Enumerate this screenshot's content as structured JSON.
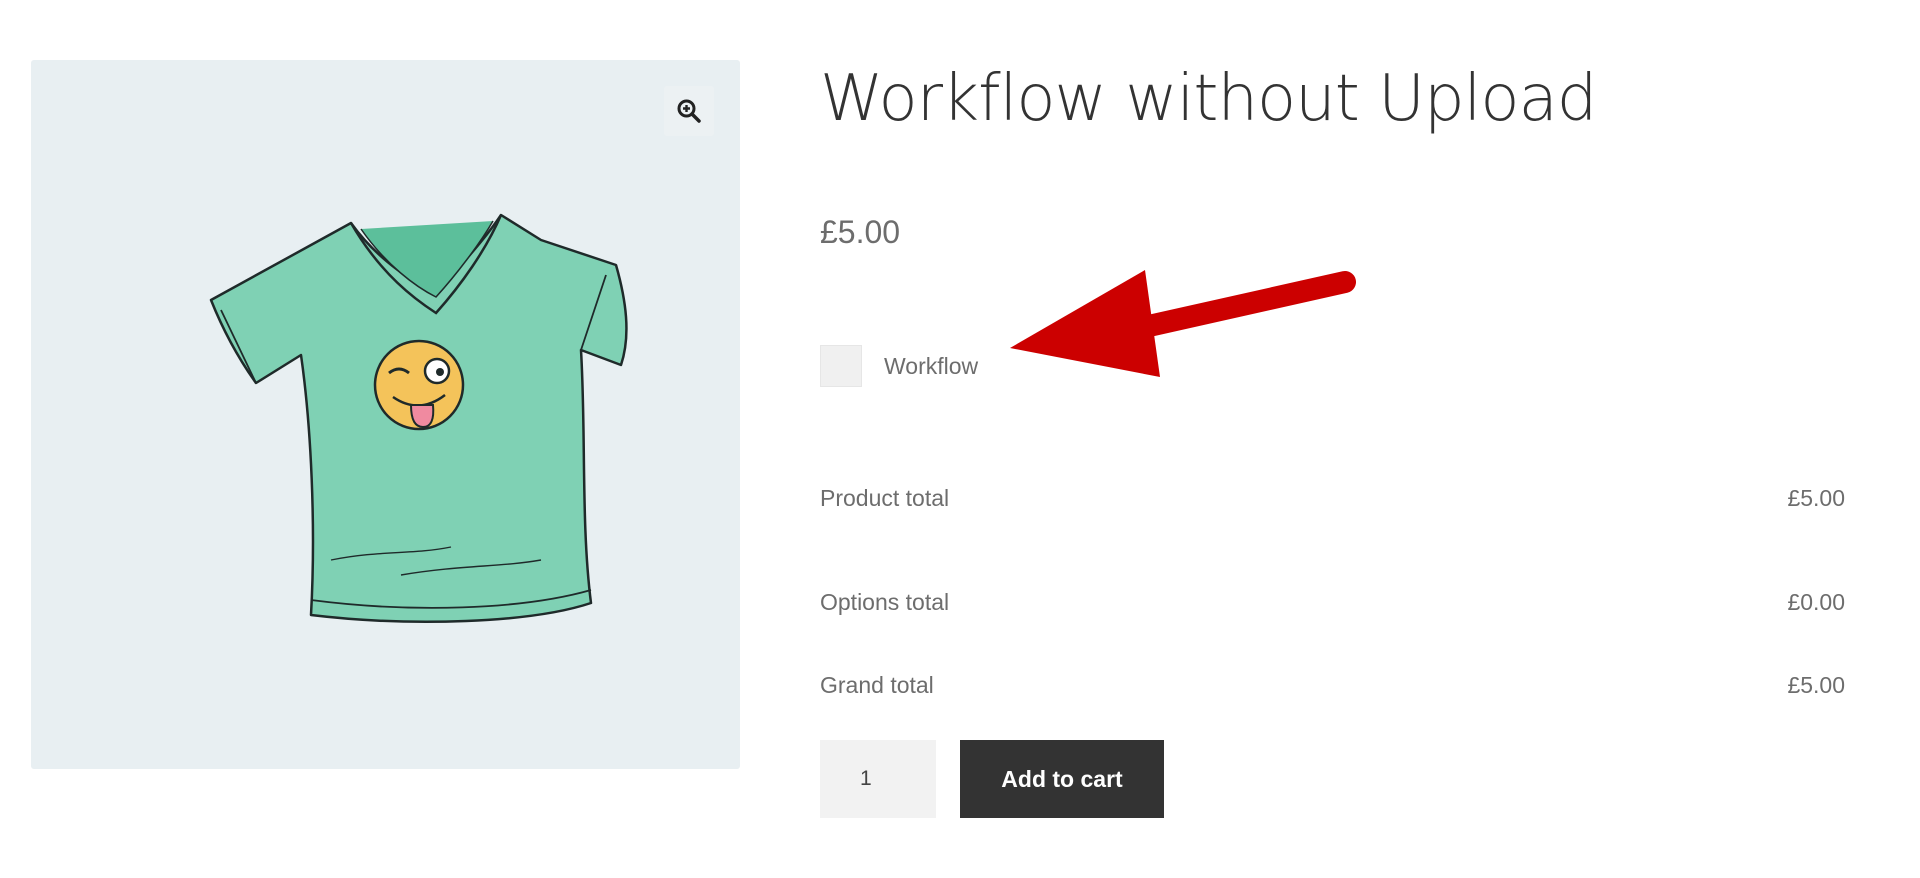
{
  "product": {
    "title": "Workflow without Upload",
    "price": "£5.00",
    "image_icon": "tshirt-winking-emoji-image",
    "zoom_icon": "zoom-in-icon"
  },
  "options": [
    {
      "label": "Workflow",
      "checked": false
    }
  ],
  "totals": [
    {
      "label": "Product total",
      "value": "£5.00"
    },
    {
      "label": "Options total",
      "value": "£0.00"
    },
    {
      "label": "Grand total",
      "value": "£5.00"
    }
  ],
  "cart": {
    "quantity": "1",
    "add_to_cart_label": "Add to cart"
  },
  "annotation": {
    "arrow_icon": "red-arrow-icon",
    "arrow_color": "#cc0000"
  },
  "colors": {
    "gallery_bg": "#e8eff2",
    "button_bg": "#333333",
    "shirt": "#7fd1b4"
  }
}
